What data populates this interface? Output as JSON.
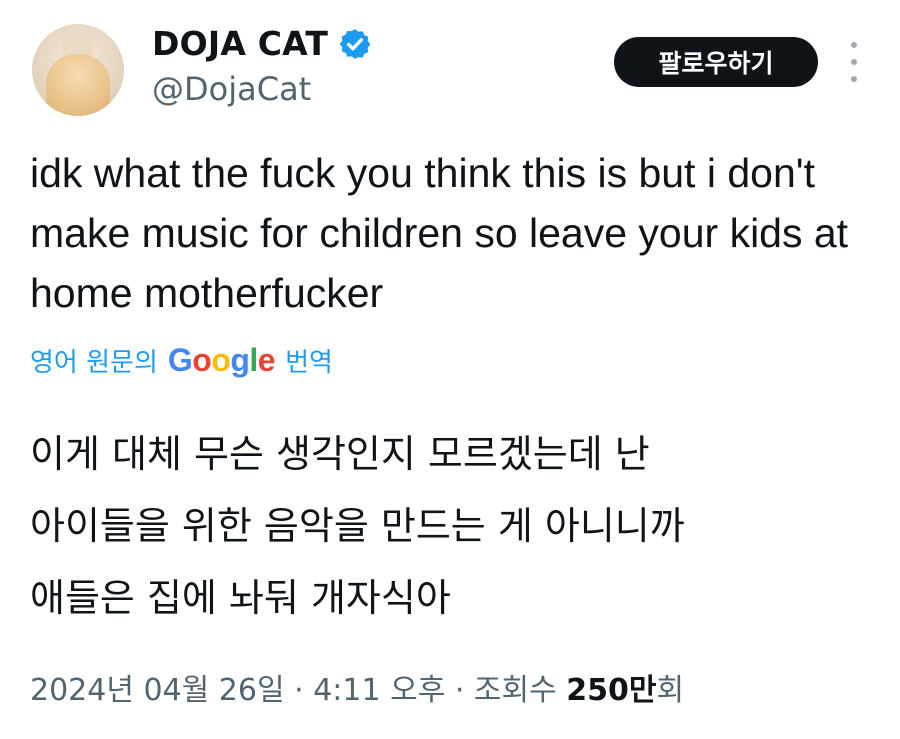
{
  "author": {
    "display_name": "DOJA CAT",
    "handle": "@DojaCat",
    "verified": true,
    "verified_color": "#1d9bf0"
  },
  "actions": {
    "follow_label": "팔로우하기",
    "more_icon": "more-vertical-icon"
  },
  "tweet": {
    "text": "idk what the fuck you think this is but i don't make music for children so leave your kids at home motherfucker"
  },
  "translation": {
    "label": "영어 원문의",
    "provider": "Google",
    "suffix": "번역",
    "lines": [
      "이게 대체 무슨 생각인지 모르겠는데 난",
      "아이들을 위한 음악을 만드는 게 아니니까",
      "애들은 집에 놔둬 개자식아"
    ]
  },
  "meta": {
    "date": "2024년 04월 26일",
    "separator": " · ",
    "time": "4:11 오후",
    "views_label": "조회수",
    "views_count": "250만",
    "views_unit": "회"
  },
  "colors": {
    "accent": "#1d9bf0",
    "text": "#0f1419",
    "muted": "#536471",
    "button_bg": "#0f1419"
  }
}
